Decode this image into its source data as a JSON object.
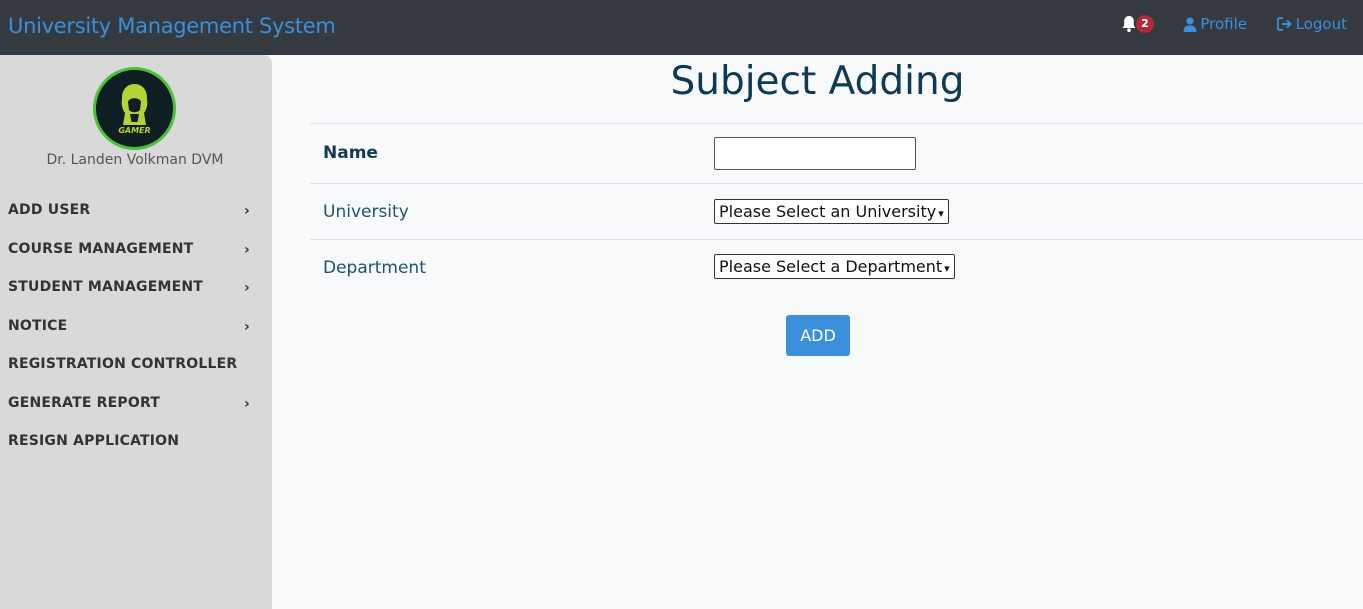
{
  "header": {
    "brand": "University Management System",
    "notification_count": "2",
    "profile_label": "Profile",
    "logout_label": "Logout"
  },
  "sidebar": {
    "avatar_text": "GAMER",
    "user_name": "Dr. Landen Volkman DVM",
    "items": [
      {
        "label": "ADD USER",
        "has_submenu": true
      },
      {
        "label": "COURSE MANAGEMENT",
        "has_submenu": true
      },
      {
        "label": "STUDENT MANAGEMENT",
        "has_submenu": true
      },
      {
        "label": "NOTICE",
        "has_submenu": true
      },
      {
        "label": "REGISTRATION CONTROLLER",
        "has_submenu": false
      },
      {
        "label": "GENERATE REPORT",
        "has_submenu": true
      },
      {
        "label": "RESIGN APPLICATION",
        "has_submenu": false
      }
    ],
    "chevron": "›"
  },
  "form": {
    "title": "Subject Adding",
    "name_label": "Name",
    "name_value": "",
    "university_label": "University",
    "university_selected": "Please Select an University",
    "department_label": "Department",
    "department_selected": "Please Select a Department",
    "submit_label": "ADD"
  },
  "colors": {
    "topbar": "#343a40",
    "brand": "#3b8fdb",
    "sidebar": "#d9d9d9",
    "title": "#0e3a53",
    "button": "#3b8fdb",
    "badge": "#b02a37"
  }
}
